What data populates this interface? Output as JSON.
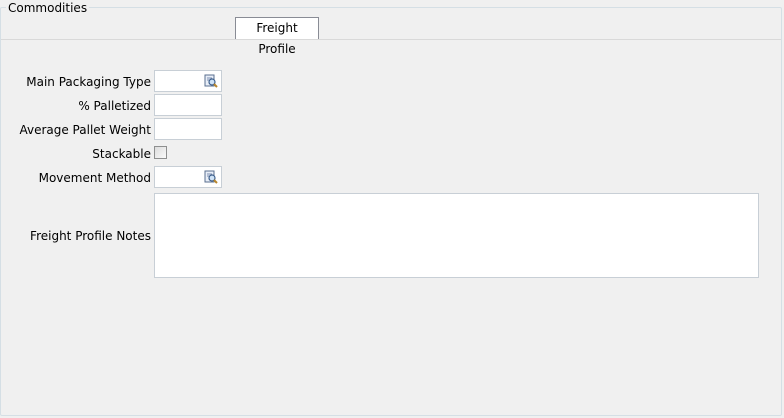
{
  "group": {
    "title": "Commodities"
  },
  "tabs": [
    {
      "label": "Freight Profile",
      "selected": true
    }
  ],
  "form": {
    "main_packaging_type": {
      "label": "Main Packaging Type",
      "value": ""
    },
    "pct_palletized": {
      "label": "% Palletized",
      "value": ""
    },
    "avg_pallet_weight": {
      "label": "Average Pallet Weight",
      "value": ""
    },
    "stackable": {
      "label": "Stackable",
      "checked": false
    },
    "movement_method": {
      "label": "Movement Method",
      "value": ""
    },
    "notes": {
      "label": "Freight Profile Notes",
      "value": ""
    }
  },
  "icons": {
    "lookup": "lookup-icon"
  },
  "colors": {
    "background": "#f0f0f0",
    "field_border": "#c8cfd6",
    "group_border": "#d5dfe5"
  }
}
